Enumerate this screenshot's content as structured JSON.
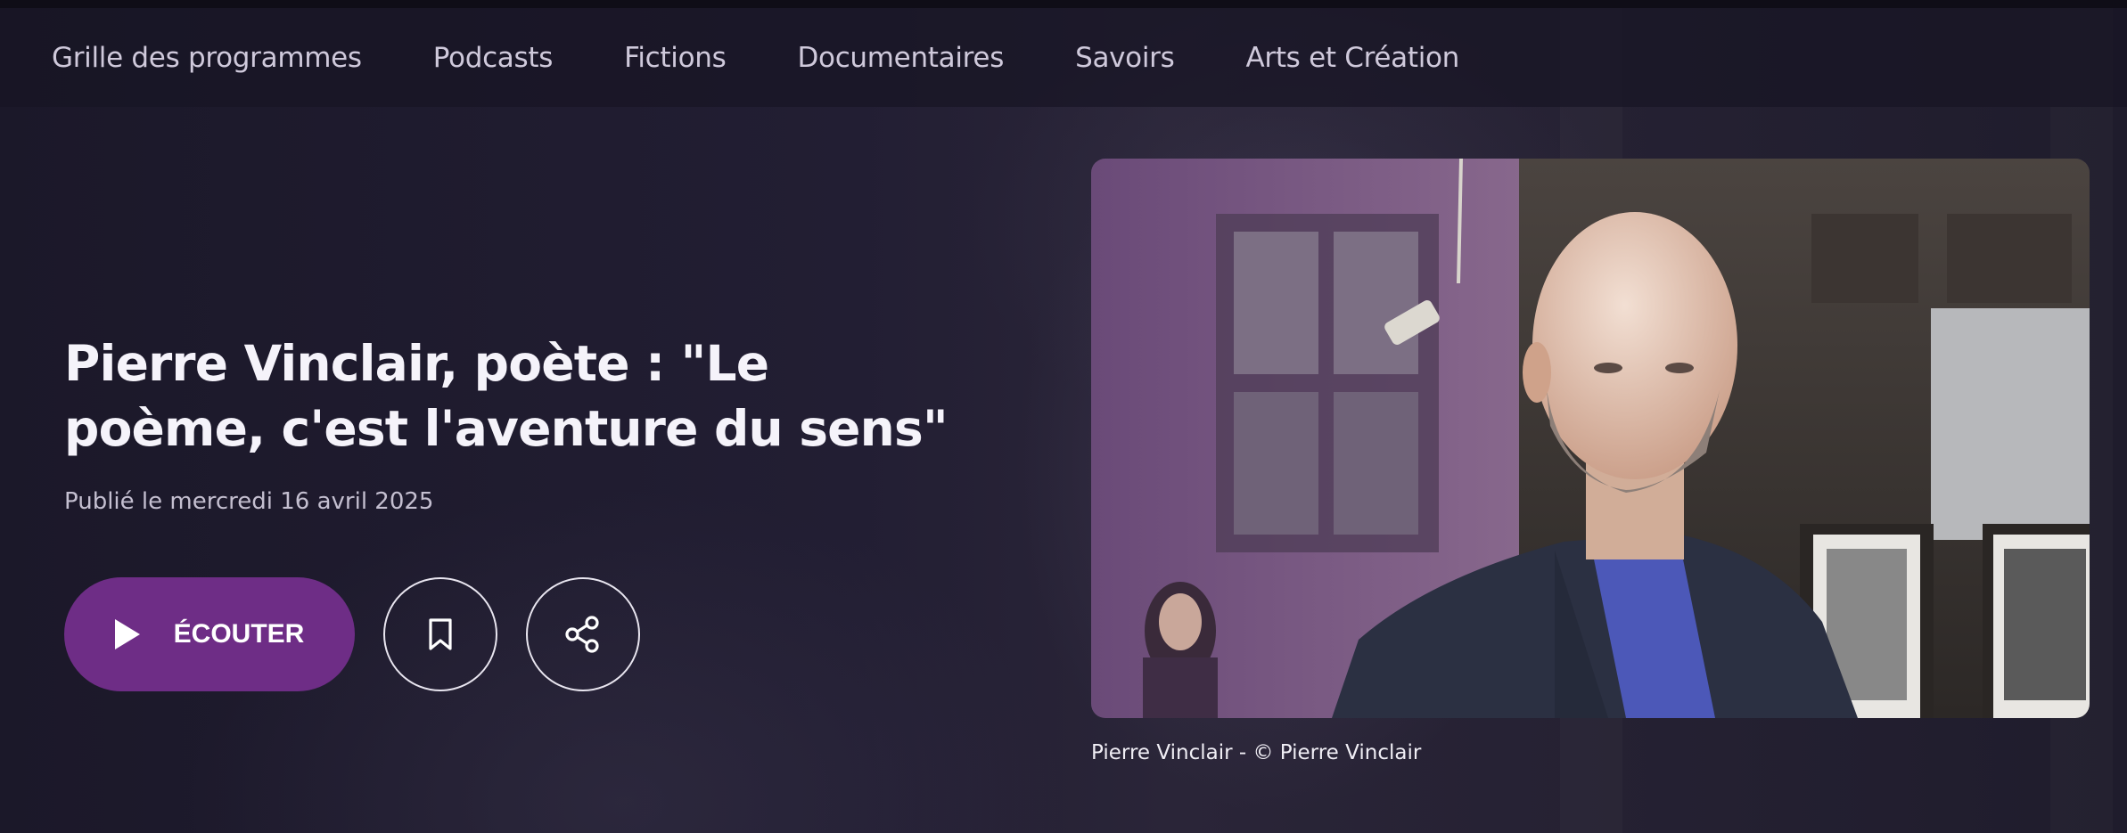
{
  "nav": {
    "items": [
      {
        "label": "Grille des programmes"
      },
      {
        "label": "Podcasts"
      },
      {
        "label": "Fictions"
      },
      {
        "label": "Documentaires"
      },
      {
        "label": "Savoirs"
      },
      {
        "label": "Arts et Création"
      }
    ]
  },
  "article": {
    "title_line1": "Pierre Vinclair, poète : \"Le",
    "title_line2": "poème, c'est l'aventure du sens\"",
    "published": "Publié le mercredi 16 avril 2025"
  },
  "actions": {
    "listen_label": "ÉCOUTER",
    "bookmark_icon": "bookmark-icon",
    "share_icon": "share-icon"
  },
  "image": {
    "caption": "Pierre Vinclair - © Pierre Vinclair"
  },
  "colors": {
    "background": "#1a1728",
    "accent": "#6e2d86",
    "nav_text": "#cfc9db"
  }
}
